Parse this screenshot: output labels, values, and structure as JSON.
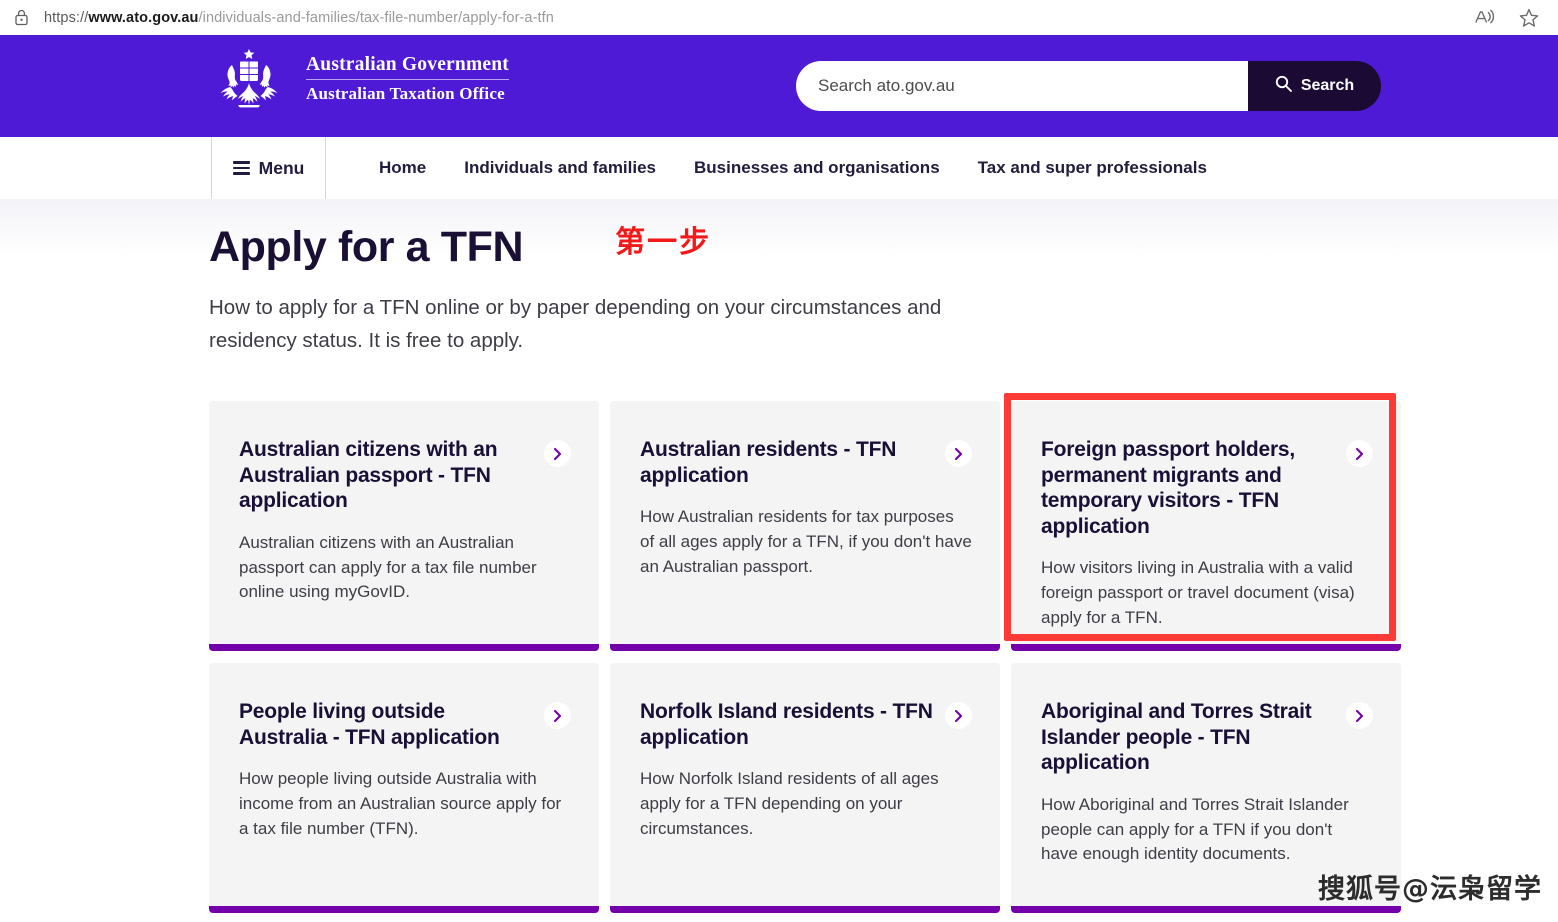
{
  "browser": {
    "url_scheme": "https://",
    "url_domain": "www.ato.gov.au",
    "url_path": "/individuals-and-families/tax-file-number/apply-for-a-tfn",
    "lock_icon": "lock-icon",
    "read_aloud_icon": "read-aloud-icon",
    "favorite_icon": "star-icon"
  },
  "header": {
    "brand_line1": "Australian Government",
    "brand_line2": "Australian Taxation Office",
    "crest_icon": "commonwealth-coat-of-arms-icon",
    "accent_purple": "#4e1ad6",
    "search": {
      "placeholder": "Search ato.gov.au",
      "value": "",
      "button_label": "Search",
      "button_icon": "search-icon",
      "button_color": "#1b0a33"
    }
  },
  "nav": {
    "menu_label": "Menu",
    "menu_icon": "hamburger-icon",
    "links": [
      {
        "label": "Home"
      },
      {
        "label": "Individuals and families"
      },
      {
        "label": "Businesses and organisations"
      },
      {
        "label": "Tax and super professionals"
      }
    ]
  },
  "main": {
    "title": "Apply for a TFN",
    "annotation": "第一步",
    "annotation_color": "#f11919",
    "intro": "How to apply for a TFN online or by paper depending on your circumstances and residency status. It is free to apply.",
    "card_accent": "#7300a8",
    "highlight_color": "#fc3a36",
    "cards": [
      {
        "title": "Australian citizens with an Australian passport - TFN application",
        "desc": "Australian citizens with an Australian passport can apply for a tax file number online using myGovID.",
        "arrow_icon": "chevron-right-icon",
        "highlighted": false
      },
      {
        "title": "Australian residents - TFN application",
        "desc": "How Australian residents for tax purposes of all ages apply for a TFN, if you don't have an Australian passport.",
        "arrow_icon": "chevron-right-icon",
        "highlighted": false
      },
      {
        "title": "Foreign passport holders, permanent migrants and temporary visitors - TFN application",
        "desc": "How visitors living in Australia with a valid foreign passport or travel document (visa) apply for a TFN.",
        "arrow_icon": "chevron-right-icon",
        "highlighted": true
      },
      {
        "title": "People living outside Australia - TFN application",
        "desc": "How people living outside Australia with income from an Australian source apply for a tax file number (TFN).",
        "arrow_icon": "chevron-right-icon",
        "highlighted": false
      },
      {
        "title": "Norfolk Island residents - TFN application",
        "desc": "How Norfolk Island residents of all ages apply for a TFN depending on your circumstances.",
        "arrow_icon": "chevron-right-icon",
        "highlighted": false
      },
      {
        "title": "Aboriginal and Torres Strait Islander people - TFN application",
        "desc": "How Aboriginal and Torres Strait Islander people can apply for a TFN if you don't have enough identity documents.",
        "arrow_icon": "chevron-right-icon",
        "highlighted": false
      }
    ]
  },
  "watermark": {
    "text": "搜狐号@沄枭留学"
  }
}
